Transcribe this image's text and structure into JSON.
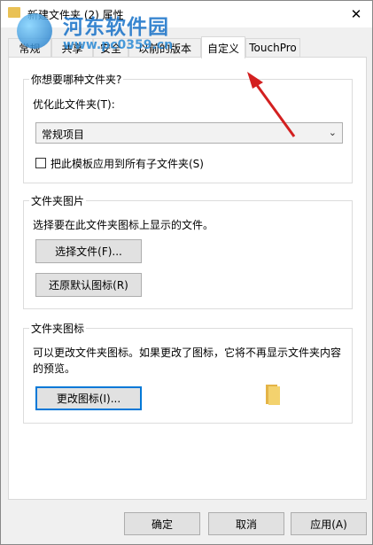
{
  "window": {
    "title": "新建文件夹 (2) 属性",
    "close_label": "✕"
  },
  "watermark": {
    "main": "河东软件园",
    "url": "www.pc0359.cn"
  },
  "tabs": [
    {
      "label": "常规"
    },
    {
      "label": "共享"
    },
    {
      "label": "安全"
    },
    {
      "label": "以前的版本"
    },
    {
      "label": "自定义"
    },
    {
      "label": "TouchPro"
    }
  ],
  "active_tab": "自定义",
  "optimize_group": {
    "title": "你想要哪种文件夹?",
    "optimize_label": "优化此文件夹(T):",
    "select_value": "常规项目",
    "checkbox_label": "把此模板应用到所有子文件夹(S)",
    "checkbox_checked": false
  },
  "picture_group": {
    "title": "文件夹图片",
    "description": "选择要在此文件夹图标上显示的文件。",
    "choose_file_label": "选择文件(F)...",
    "restore_default_label": "还原默认图标(R)"
  },
  "icon_group": {
    "title": "文件夹图标",
    "description_line1": "可以更改文件夹图标。如果更改了图标，它将不再显示文件夹内容",
    "description_line2": "的预览。",
    "change_icon_label": "更改图标(I)..."
  },
  "footer": {
    "ok_label": "确定",
    "cancel_label": "取消",
    "apply_label": "应用(A)"
  },
  "colors": {
    "focus_border": "#0078d7",
    "arrow": "#d32020",
    "folder": "#f3d26e"
  }
}
